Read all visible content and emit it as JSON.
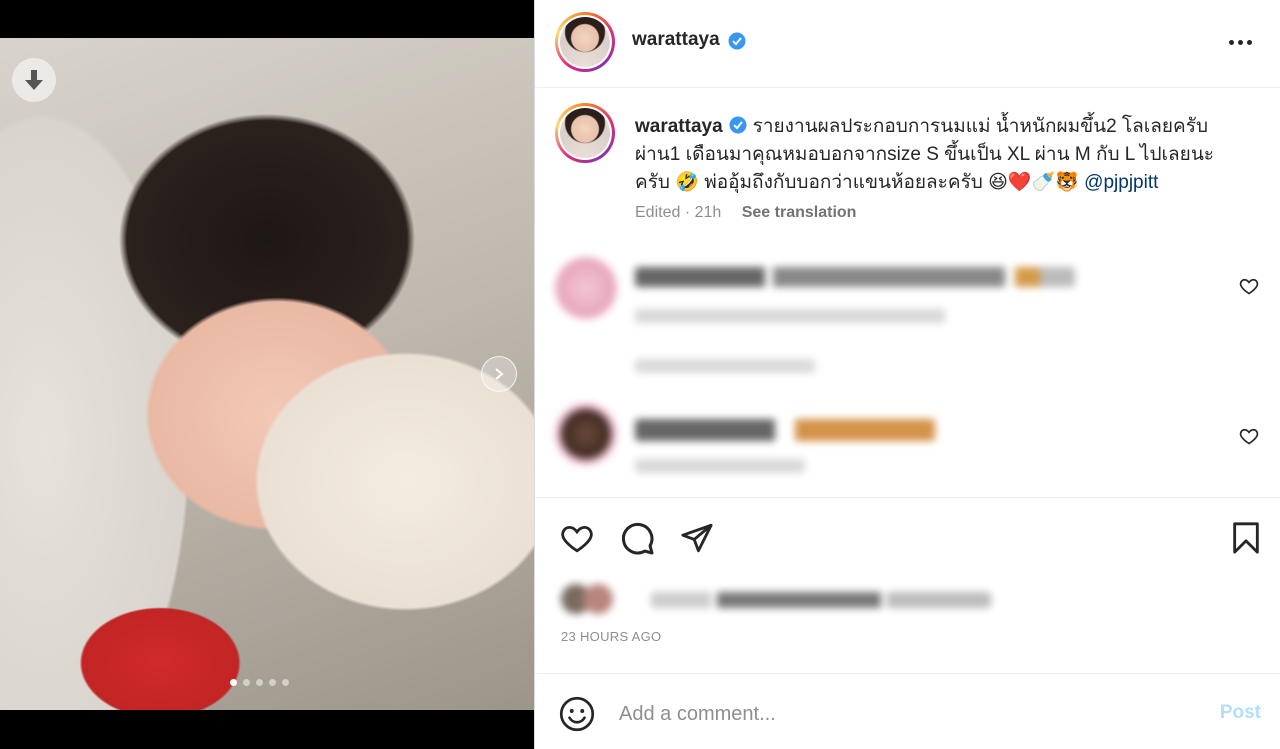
{
  "post": {
    "username": "warattaya",
    "caption": "รายงานผลประกอบการนมแม่ น้ำหนักผมขึ้น2 โลเลยครับ ผ่าน1 เดือนมาคุณหมอบอกจากsize S ขึ้นเป็น XL ผ่าน M กับ L ไปเลยนะครับ 🤣 พ่ออุ้มถึงกับบอกว่าแขนห้อยละครับ 😆❤️🍼🐯 ",
    "mention": "@pjpjpitt",
    "edited_label": "Edited · 21h",
    "see_translation": "See translation",
    "timestamp": "23 HOURS AGO",
    "carousel_total": 5,
    "carousel_active": 1
  },
  "comment_box": {
    "placeholder": "Add a comment...",
    "post_label": "Post"
  },
  "colors": {
    "verified": "#3897f0",
    "post_button": "#b2dffc",
    "mention": "#00376b"
  },
  "icons": [
    "download-icon",
    "next-arrow-icon",
    "verified-icon",
    "more-options-icon",
    "heart-icon",
    "comment-icon",
    "share-icon",
    "save-icon",
    "emoji-icon"
  ]
}
